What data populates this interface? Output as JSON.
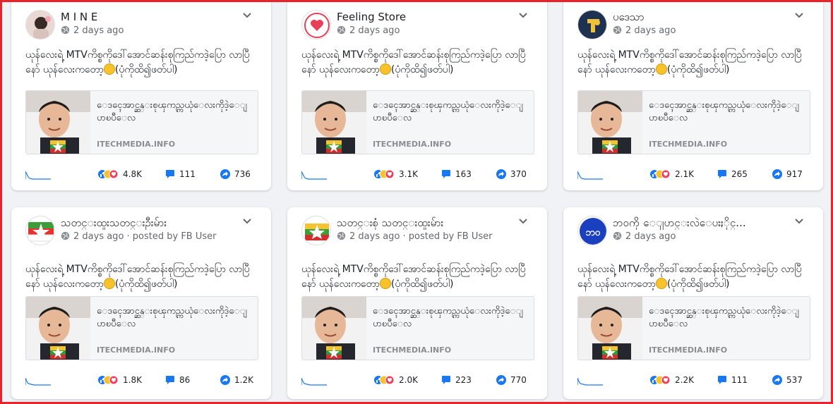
{
  "message_part1": "ယုန်လေးရဲ့ MTVကိစ္စကိုဒေါ်အောင်ဆန်းစုကြည်ကဒဲ့ပြော လာပြီနော် ယုန်လေးကတော့",
  "message_part2": "(ပုံကိုထိ၍ဖတ်ပါ)",
  "link_title": "ေဒၚေအာင္ဆန္းစုၾကည္ကယုံေလးကိုဒဲ့ေျပာၿပီေလ",
  "link_domain": "ITECHMEDIA.INFO",
  "colors": {
    "accent": "#1877f2",
    "frame": "#e8232b"
  },
  "posts": [
    {
      "name": "M I N E",
      "meta": "2 days ago",
      "reactions": "4.8K",
      "comments": "111",
      "shares": "736"
    },
    {
      "name": "Feeling Store",
      "meta": "2 days ago",
      "reactions": "3.1K",
      "comments": "163",
      "shares": "370"
    },
    {
      "name": "ပဒေသာ",
      "meta": "2 days ago",
      "reactions": "2.1K",
      "comments": "265",
      "shares": "917"
    },
    {
      "name": "သတင္းထူးသတင္းဦးမ်ား",
      "meta": "2 days ago · posted by FB User",
      "reactions": "1.8K",
      "comments": "86",
      "shares": "1.2K"
    },
    {
      "name": "သတင္းစုံ သတင္းထူးမ်ား",
      "meta": "2 days ago · posted by FB User",
      "reactions": "2.0K",
      "comments": "223",
      "shares": "770"
    },
    {
      "name": "ဘ၀ကို ေျပာင္းလဲေပးႏိုင္...",
      "meta": "2 days ago",
      "reactions": "2.2K",
      "comments": "111",
      "shares": "537"
    }
  ],
  "icons": {
    "globe": "globe-icon",
    "options": "chevron-down-icon",
    "reactions": "reactions-icon",
    "comments": "comment-icon",
    "shares": "share-icon",
    "trend": "sparkline-icon"
  }
}
